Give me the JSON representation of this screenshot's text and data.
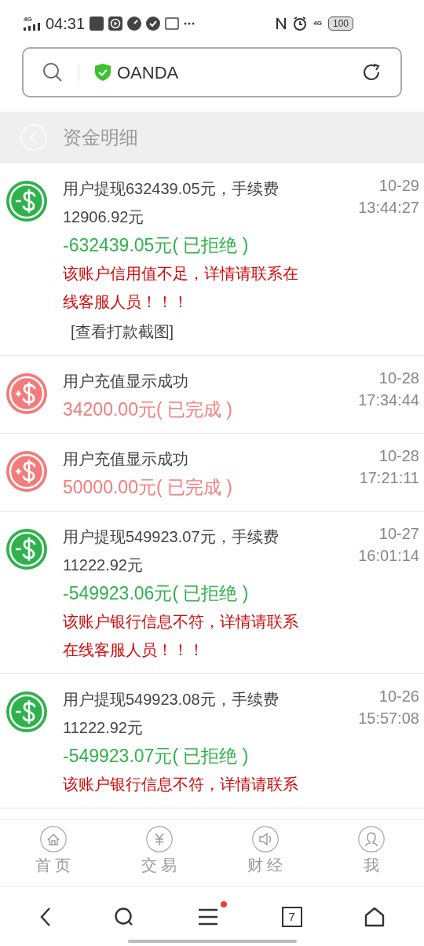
{
  "status_bar": {
    "network": "4G",
    "time": "04:31",
    "network_right": "4G",
    "battery": "100"
  },
  "address_bar": {
    "site": "OANDA"
  },
  "header": {
    "title": "资金明细"
  },
  "records": [
    {
      "kind": "withdraw",
      "title": "用户提现632439.05元，手续费12906.92元",
      "amount": "-632439.05元( 已拒绝 )",
      "note": "该账户信用值不足，详情请联系在线客服人员！！！",
      "link": "[查看打款截图]",
      "date": "10-29",
      "time": "13:44:27"
    },
    {
      "kind": "deposit",
      "title": "用户充值显示成功",
      "amount": "34200.00元( 已完成 )",
      "date": "10-28",
      "time": "17:34:44"
    },
    {
      "kind": "deposit",
      "title": "用户充值显示成功",
      "amount": "50000.00元( 已完成 )",
      "date": "10-28",
      "time": "17:21:11"
    },
    {
      "kind": "withdraw",
      "title": "用户提现549923.07元，手续费11222.92元",
      "amount": "-549923.06元( 已拒绝 )",
      "note": "该账户银行信息不符，详情请联系在线客服人员！！！",
      "date": "10-27",
      "time": "16:01:14"
    },
    {
      "kind": "withdraw",
      "title": "用户提现549923.08元，手续费11222.92元",
      "amount": "-549923.07元( 已拒绝 )",
      "note": "该账户银行信息不符，详情请联系",
      "date": "10-26",
      "time": "15:57:08"
    }
  ],
  "tabs": [
    {
      "kind": "home",
      "label": "首 页"
    },
    {
      "kind": "trade",
      "label": "交 易"
    },
    {
      "kind": "finance",
      "label": "财 经"
    },
    {
      "kind": "me",
      "label": "我"
    }
  ],
  "browser_nav": {
    "tab_count": "7",
    "menu_badge": true
  }
}
